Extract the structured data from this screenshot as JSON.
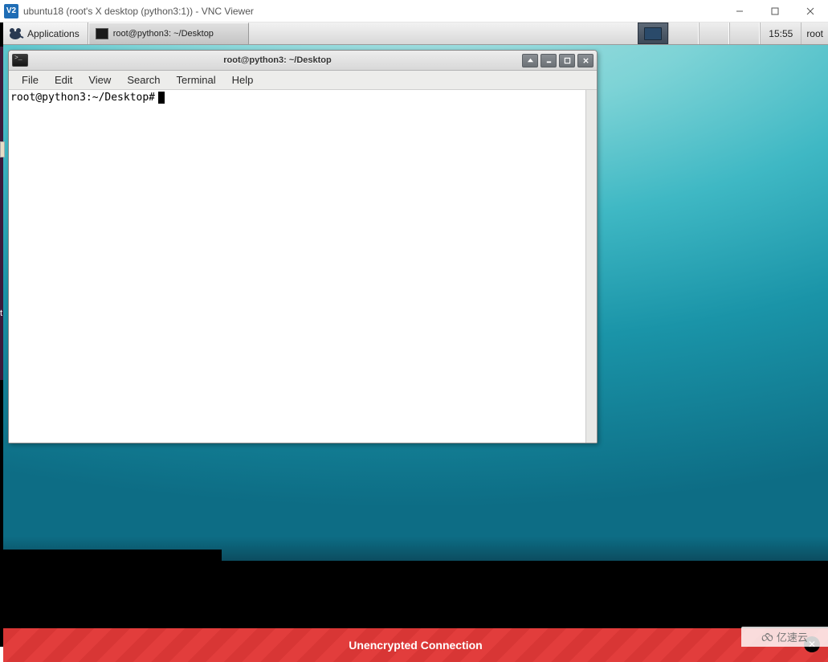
{
  "win_title": "ubuntu18 (root's X desktop (python3:1)) - VNC Viewer",
  "vnc_icon_text": "V2",
  "xfce": {
    "apps_label": "Applications",
    "task_label": "root@python3: ~/Desktop",
    "clock": "15:55",
    "user": "root"
  },
  "terminal": {
    "title": "root@python3: ~/Desktop",
    "menus": [
      "File",
      "Edit",
      "View",
      "Search",
      "Terminal",
      "Help"
    ],
    "prompt": "root@python3:~/Desktop#"
  },
  "banner": {
    "text": "Unencrypted Connection",
    "close": "✕"
  },
  "watermark": "亿速云"
}
